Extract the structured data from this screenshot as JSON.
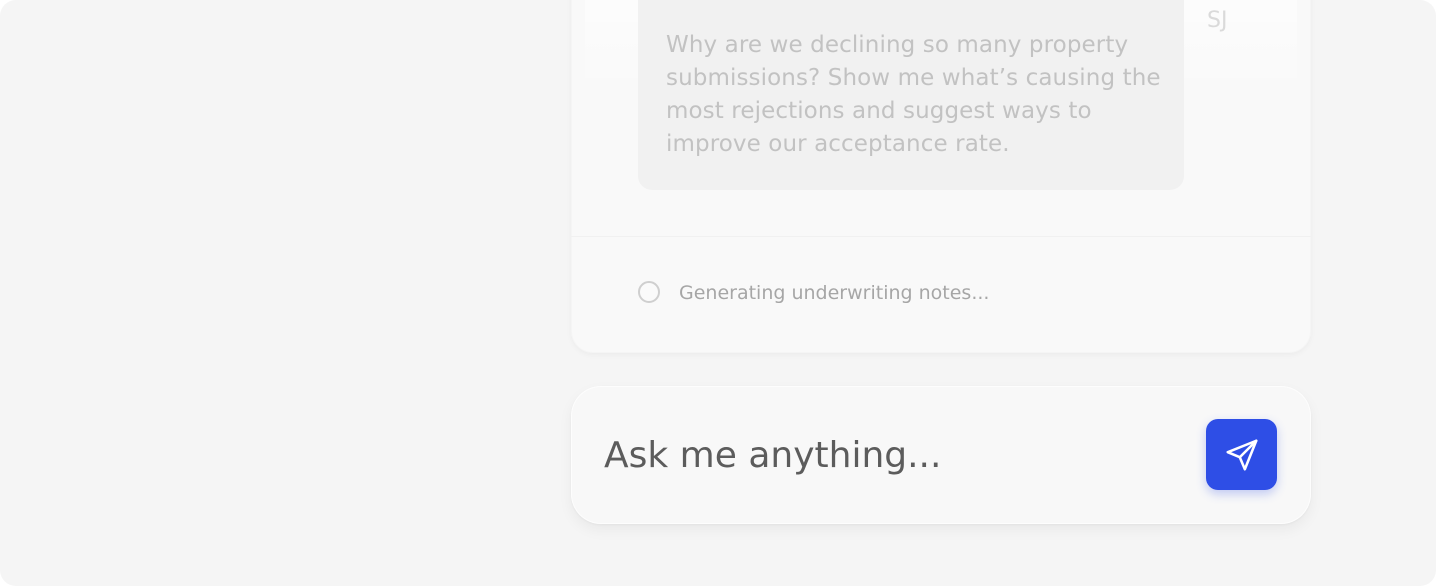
{
  "conversation": {
    "user_message": "Why are we declining so many property submissions? Show me what’s causing the most rejections and suggest ways to improve our acceptance rate.",
    "user_initials": "SJ",
    "status_text": "Generating underwriting notes..."
  },
  "composer": {
    "placeholder": "Ask me anything...",
    "value": ""
  },
  "icons": {
    "spinner": "loading-spinner-icon",
    "send": "send-paper-plane-icon"
  },
  "colors": {
    "accent": "#2e4ee6",
    "background": "#f5f5f5"
  }
}
